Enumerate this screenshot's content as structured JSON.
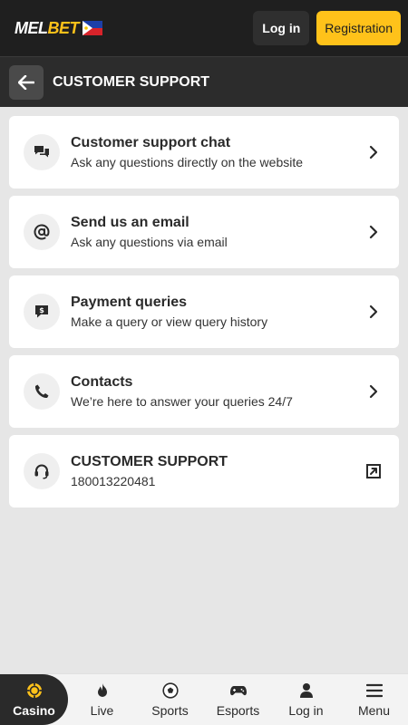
{
  "header": {
    "logo_mel": "MEL",
    "logo_bet": "BET",
    "login_label": "Log in",
    "registration_label": "Registration"
  },
  "subheader": {
    "title": "CUSTOMER SUPPORT"
  },
  "items": [
    {
      "title": "Customer support chat",
      "subtitle": "Ask any questions directly on the website",
      "icon": "chat-icon",
      "action": "chevron-right-icon"
    },
    {
      "title": "Send us an email",
      "subtitle": "Ask any questions via email",
      "icon": "at-icon",
      "action": "chevron-right-icon"
    },
    {
      "title": "Payment queries",
      "subtitle": "Make a query or view query history",
      "icon": "payment-icon",
      "action": "chevron-right-icon"
    },
    {
      "title": "Contacts",
      "subtitle": "We’re here to answer your queries 24/7",
      "icon": "phone-icon",
      "action": "chevron-right-icon"
    },
    {
      "title": "CUSTOMER SUPPORT",
      "subtitle": "180013220481",
      "icon": "headset-icon",
      "action": "external-link-icon"
    }
  ],
  "nav": [
    {
      "label": "Casino",
      "icon": "casino-chip-icon",
      "active": true
    },
    {
      "label": "Live",
      "icon": "flame-icon"
    },
    {
      "label": "Sports",
      "icon": "soccer-ball-icon"
    },
    {
      "label": "Esports",
      "icon": "gamepad-icon"
    },
    {
      "label": "Log in",
      "icon": "user-icon"
    },
    {
      "label": "Menu",
      "icon": "hamburger-icon"
    }
  ],
  "colors": {
    "accent": "#ffc21a",
    "topbar": "#1f1f1f",
    "subheader": "#2c2c2c",
    "background": "#e6e6e6"
  }
}
